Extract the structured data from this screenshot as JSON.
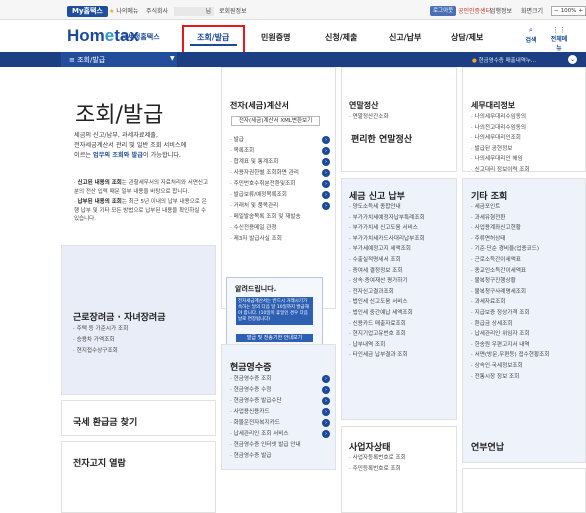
{
  "topbar": {
    "mytax": "My홈택스",
    "favorites": "나의메뉴",
    "company": "주식회사",
    "user_suffix": "님",
    "user_info": "로회원정보",
    "logout": "로그아웃",
    "cert_center": "공인인증센터",
    "biz_request": "업행정보",
    "view": "화면크기",
    "zoom": "100%"
  },
  "header": {
    "logo_main": "Hom",
    "logo_e": "e",
    "logo_end": "tax",
    "logo_sub": "국세청홈택스",
    "nav": [
      "조회/발급",
      "민원증명",
      "신청/제출",
      "신고/납부",
      "상담/제보"
    ],
    "search_label": "검색",
    "allmenu_label": "전체메뉴"
  },
  "subbar": {
    "title": "조회/발급",
    "right_text": "현금영수증 매출내역누..."
  },
  "left": {
    "title": "조회/발급",
    "intro_1": "세금의 신고/납부, 과세자료제출,",
    "intro_2": "전자세금계산서 관리 및 일반 조회 서비스에",
    "intro_3_pre": "이르는 ",
    "intro_3_hl": "업무의 조회와 발급",
    "intro_3_post": "이 가능합니다.",
    "notes": [
      {
        "b": "신고된 내용의 조회",
        "t": "는 관할세무서의 자료처리와 서면신고분의 전산 입력 때문 일부 내용을 바탕으로 합니다."
      },
      {
        "b": "납부된 내용의 조회",
        "t": "는 최근 5년 이내의 납부 내용으로 은행 납부 및 기타 모든 방법으로 납부된 내용을 확인하실 수 있습니다."
      }
    ]
  },
  "etax": {
    "title": "전자(세금)계산서",
    "xml_btn": "전자(세금)계산서 XML변환보기",
    "items": [
      "발급",
      "목록조회",
      "합계표 및 통계조회",
      "사용자권한별 조회화면 관리",
      "주민번호수취분전환및조회",
      "발급보류/예정목록조회",
      "거래처 및 품목관리",
      "메일발송목록 조회 및 재발송",
      "수신전용메일 관청",
      "제3자 발급사실 조회"
    ]
  },
  "yearend": {
    "title": "연말정산",
    "items": [
      "연말정산간소화"
    ],
    "easy": "편리한 연말정산"
  },
  "agent": {
    "title": "세무대리정보",
    "items": [
      "나의세무대리수임동의",
      "나의전고대리수임동의",
      "나의세무대리인조회",
      "발급된 공현정보",
      "나의세무대리인 해임",
      "신고대리 정보이력 조회"
    ]
  },
  "notice": {
    "title": "알려드립니다.",
    "text": "전자세금계산서는 반드시 거래시기가 속하는 달의 다음 달 10일까지 발급해야 합니다. (10일이 휴일인 경우 다음날로 연장됩니다)",
    "btn": "발급 및 전송기한 안내보기"
  },
  "tax_report": {
    "title": "세금 신고 납부",
    "items": [
      "양도소득세 종합안내",
      "부가가치세예정자납부특례조회",
      "부가가치세 신고도움 서비스",
      "부가가치세카드사대리납부조회",
      "부가세예정고지 세액조회",
      "수출실적명세서 조회",
      "증여세 결정정보 조회",
      "상속·증여재산 평가하기",
      "전자신고결과조회",
      "법인세 신고도움 서비스",
      "법인세 중간예납 세액조회",
      "신용카드 매출자료조회",
      "현지기업고유번호 조회",
      "납부내역 조회",
      "타인세금 납부결과 조회"
    ]
  },
  "etc": {
    "title": "기타 조회",
    "items": [
      "세금포인트",
      "과세유형전환",
      "사업용계좌신고현황",
      "주류면허상태",
      "기준·단순 경비율(업종코드)",
      "근로소득간이세액표",
      "종교인소득간이세액표",
      "불복청구진행상황",
      "불복청구사례명세조회",
      "과세자료조회",
      "지급보증 정상가격 조회",
      "환급금 상세조회",
      "납세관리인 위임자 조회",
      "한송원 우편고지서 내역",
      "서면(방문,우편등) 접수현황조회",
      "상속인·국세정보조회",
      "전통시장 정보 조회"
    ]
  },
  "cash": {
    "title": "현금영수증",
    "items": [
      "현금영수증 조회",
      "현금영수증 수정",
      "현금영수증 발급수단",
      "사업용신용카드",
      "화물운전자복지카드",
      "납세관리인 조회 서비스",
      "현금영수증 인터넷 발급 안내",
      "현금영수증 발급"
    ]
  },
  "earned": {
    "title": "근로장려금 · 자녀장려금",
    "items": [
      "주택 등 가준시가 조회",
      "승용차 가액조회",
      "현지접수상구조회"
    ]
  },
  "bottom": {
    "refund": "국세 환급금 찾기",
    "notice_view": "전자고지 열람",
    "biz_status": "사업자상태",
    "biz_items": [
      "사업자등록번호로 조회",
      "주민등록번호로 조회"
    ],
    "pension": "연부연납"
  }
}
